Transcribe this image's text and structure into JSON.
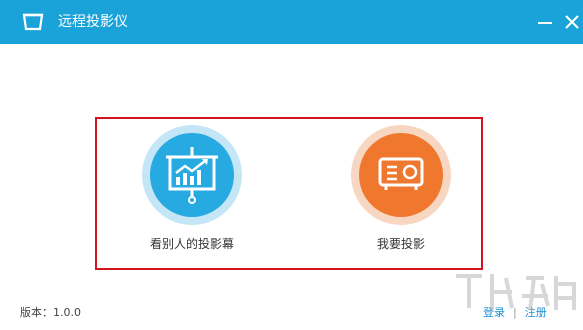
{
  "window": {
    "title": "远程投影仪",
    "app_icon": "screen-frame-icon",
    "controls": {
      "minimize_icon": "minimize-icon",
      "close_icon": "close-icon"
    }
  },
  "options": [
    {
      "label": "看别人的投影幕",
      "icon": "presentation-chart-icon",
      "color": "#27aae1"
    },
    {
      "label": "我要投影",
      "icon": "projector-icon",
      "color": "#f0782e"
    }
  ],
  "footer": {
    "version": "版本：1.0.0",
    "login": "登录",
    "separator": "|",
    "register": "注册"
  },
  "theme": {
    "titlebar": "#1aa3d9",
    "highlight_border": "#d4141e"
  }
}
